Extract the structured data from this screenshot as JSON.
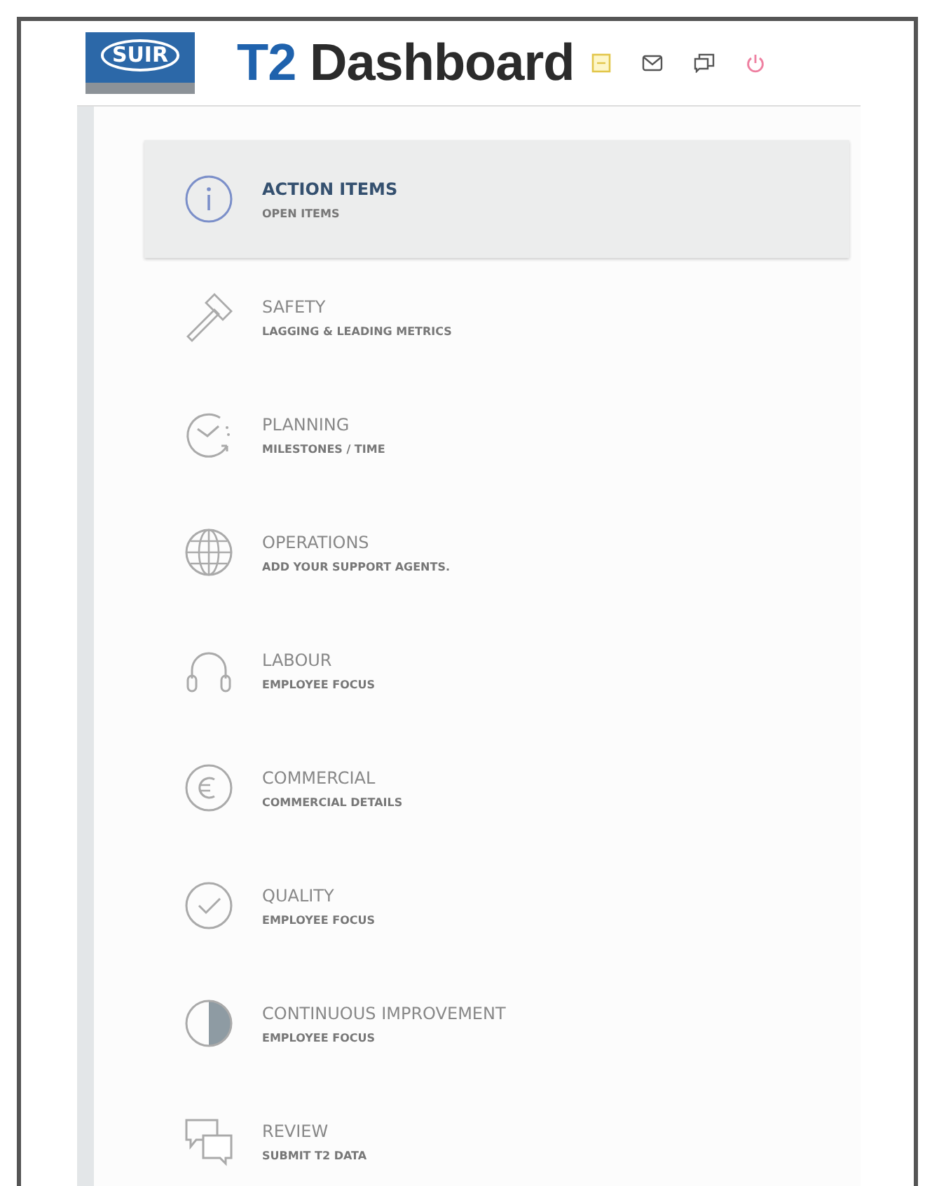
{
  "logo": {
    "text": "SUIR"
  },
  "header": {
    "title_prefix": "T2",
    "title": "Dashboard"
  },
  "menu": [
    {
      "kind": "info",
      "title": "ACTION ITEMS",
      "subtitle": "OPEN ITEMS",
      "selected": true
    },
    {
      "kind": "hammer",
      "title": "SAFETY",
      "subtitle": "LAGGING & LEADING METRICS",
      "selected": false
    },
    {
      "kind": "clock",
      "title": "PLANNING",
      "subtitle": "MILESTONES / TIME",
      "selected": false
    },
    {
      "kind": "globe",
      "title": "OPERATIONS",
      "subtitle": "ADD YOUR SUPPORT AGENTS.",
      "selected": false
    },
    {
      "kind": "headphones",
      "title": "LABOUR",
      "subtitle": "EMPLOYEE FOCUS",
      "selected": false
    },
    {
      "kind": "euro",
      "title": "COMMERCIAL",
      "subtitle": "COMMERCIAL DETAILS",
      "selected": false
    },
    {
      "kind": "check",
      "title": "QUALITY",
      "subtitle": "EMPLOYEE FOCUS",
      "selected": false
    },
    {
      "kind": "contrast",
      "title": "CONTINUOUS IMPROVEMENT",
      "subtitle": "EMPLOYEE FOCUS",
      "selected": false
    },
    {
      "kind": "chat",
      "title": "REVIEW",
      "subtitle": "SUBMIT T2 DATA",
      "selected": false
    }
  ]
}
